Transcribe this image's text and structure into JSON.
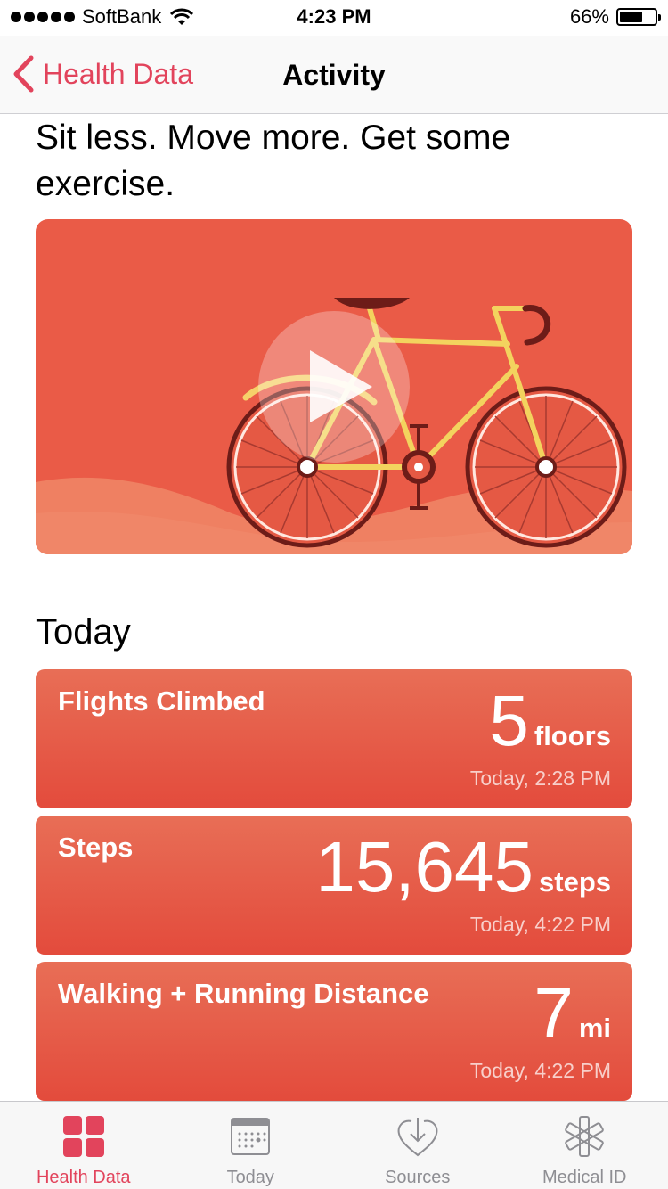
{
  "status_bar": {
    "carrier": "SoftBank",
    "time": "4:23 PM",
    "battery_percent": "66%",
    "battery_level": 0.66
  },
  "nav": {
    "back_label": "Health Data",
    "title": "Activity"
  },
  "content": {
    "headline": "Sit less. Move more. Get some exercise.",
    "section_title": "Today",
    "metrics": [
      {
        "label": "Flights Climbed",
        "value": "5",
        "unit": "floors",
        "time": "Today, 2:28 PM"
      },
      {
        "label": "Steps",
        "value": "15,645",
        "unit": "steps",
        "time": "Today, 4:22 PM"
      },
      {
        "label": "Walking + Running Distance",
        "value": "7",
        "unit": "mi",
        "time": "Today, 4:22 PM"
      }
    ]
  },
  "tab_bar": {
    "items": [
      {
        "label": "Health Data",
        "icon": "grid-icon",
        "active": true
      },
      {
        "label": "Today",
        "icon": "calendar-icon",
        "active": false
      },
      {
        "label": "Sources",
        "icon": "heart-download-icon",
        "active": false
      },
      {
        "label": "Medical ID",
        "icon": "asterisk-icon",
        "active": false
      }
    ]
  },
  "colors": {
    "accent": "#e2445c",
    "card_top": "#e86e56",
    "card_bottom": "#e34b3c",
    "video_bg": "#ea5b47"
  }
}
